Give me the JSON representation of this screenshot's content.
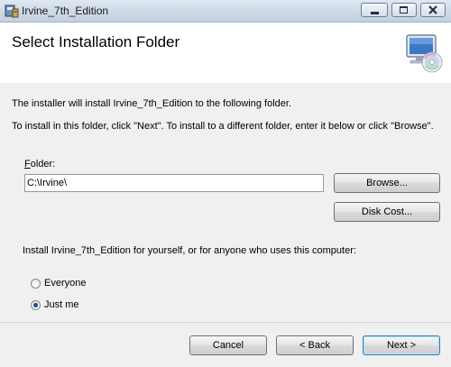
{
  "window": {
    "title": "Irvine_7th_Edition",
    "controls": {
      "minimize": "▭",
      "maximize": "□",
      "close": "✕"
    }
  },
  "header": {
    "title": "Select Installation Folder",
    "icon": "cd-computer-icon"
  },
  "body": {
    "intro": "The installer will install Irvine_7th_Edition to the following folder.",
    "instructions": "To install in this folder, click \"Next\". To install to a different folder, enter it below or click \"Browse\".",
    "folder_label": "Folder:",
    "folder_value": "C:\\Irvine\\",
    "browse_label": "Browse...",
    "disk_cost_label": "Disk Cost...",
    "install_for_label": "Install Irvine_7th_Edition for yourself, or for anyone who uses this computer:",
    "options": [
      {
        "label": "Everyone",
        "selected": false
      },
      {
        "label": "Just me",
        "selected": true
      }
    ]
  },
  "footer": {
    "cancel_label": "Cancel",
    "back_label": "< Back",
    "next_label": "Next >"
  },
  "colors": {
    "titlebar": "#cdd9e6",
    "header_bg": "#ffffff",
    "body_bg": "#f0f0f0",
    "default_button_border": "#3c7fb1"
  }
}
